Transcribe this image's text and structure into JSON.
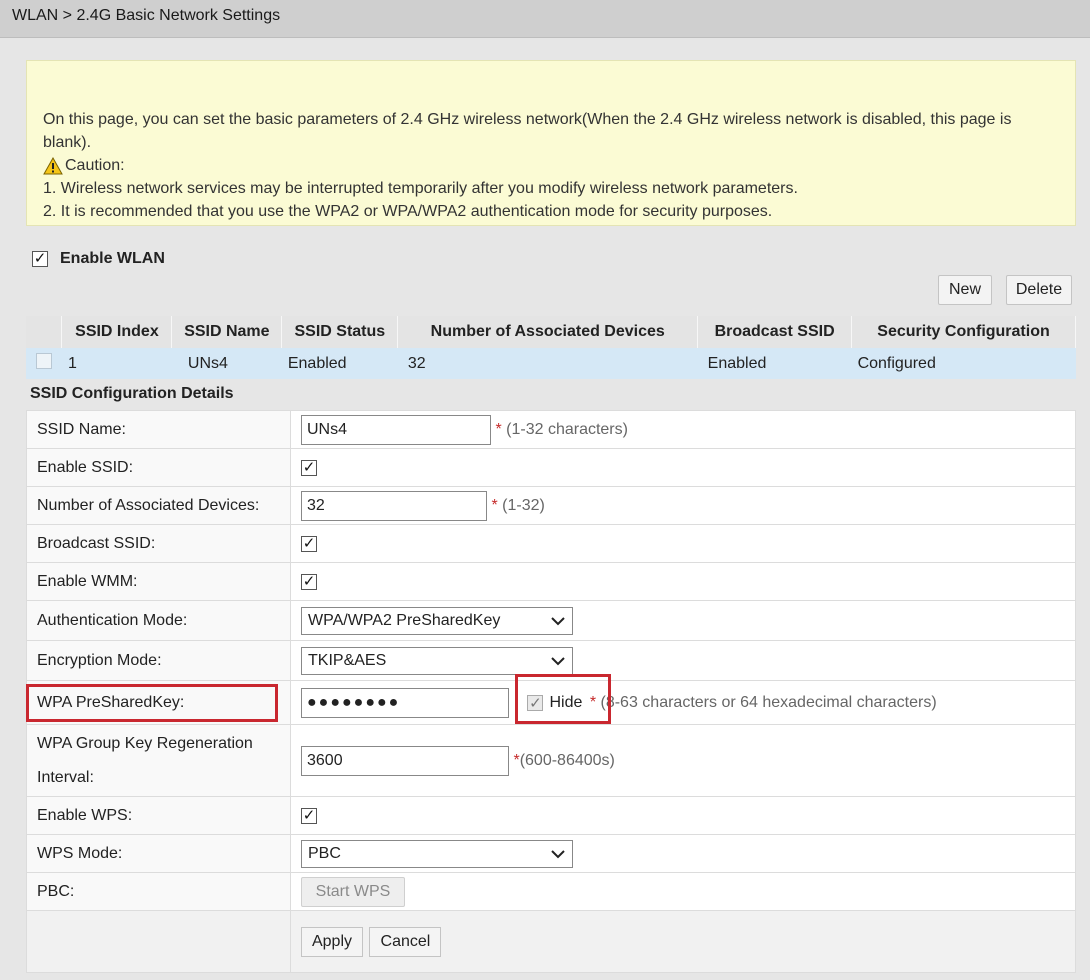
{
  "breadcrumb": "WLAN > 2.4G Basic Network Settings",
  "notice": {
    "intro": "On this page, you can set the basic parameters of 2.4 GHz wireless network(When the 2.4 GHz wireless network is disabled, this page is blank).",
    "caution_label": "Caution:",
    "item1": "1. Wireless network services may be interrupted temporarily after you modify wireless network parameters.",
    "item2": "2. It is recommended that you use the WPA2 or WPA/WPA2 authentication mode for security purposes."
  },
  "enable_wlan": {
    "label": "Enable WLAN",
    "checked": true
  },
  "toolbar": {
    "new_label": "New",
    "delete_label": "Delete"
  },
  "ssid_table": {
    "headers": [
      "SSID Index",
      "SSID Name",
      "SSID Status",
      "Number of Associated Devices",
      "Broadcast SSID",
      "Security Configuration"
    ],
    "rows": [
      {
        "index": "1",
        "name": "UNs4",
        "status": "Enabled",
        "devices": "32",
        "broadcast": "Enabled",
        "security": "Configured"
      }
    ]
  },
  "config": {
    "section_title": "SSID Configuration Details",
    "ssid_name": {
      "label": "SSID Name:",
      "value": "UNs4",
      "hint": "(1-32 characters)"
    },
    "enable_ssid": {
      "label": "Enable SSID:",
      "checked": true
    },
    "assoc_devices": {
      "label": "Number of Associated Devices:",
      "value": "32",
      "hint": "(1-32)"
    },
    "broadcast_ssid": {
      "label": "Broadcast SSID:",
      "checked": true
    },
    "enable_wmm": {
      "label": "Enable WMM:",
      "checked": true
    },
    "auth_mode": {
      "label": "Authentication Mode:",
      "selected": "WPA/WPA2 PreSharedKey"
    },
    "encryption_mode": {
      "label": "Encryption Mode:",
      "selected": "TKIP&AES"
    },
    "psk": {
      "label": "WPA PreSharedKey:",
      "masked_value": "●●●●●●●●",
      "hide_label": "Hide",
      "hide_checked": true,
      "hint": "(8-63 characters or 64 hexadecimal characters)"
    },
    "group_key": {
      "label_line1": "WPA Group Key Regeneration",
      "label_line2": "Interval:",
      "value": "3600",
      "hint": "(600-86400s)"
    },
    "enable_wps": {
      "label": "Enable WPS:",
      "checked": true
    },
    "wps_mode": {
      "label": "WPS Mode:",
      "selected": "PBC"
    },
    "pbc": {
      "label": "PBC:",
      "button": "Start WPS"
    },
    "required_mark": "*",
    "check_glyph": "✓"
  },
  "actions": {
    "apply_label": "Apply",
    "cancel_label": "Cancel"
  },
  "colors": {
    "highlight_box": "#c9272f",
    "notice_bg": "#fbfbd4",
    "selected_row_bg": "#d5e8f6"
  }
}
